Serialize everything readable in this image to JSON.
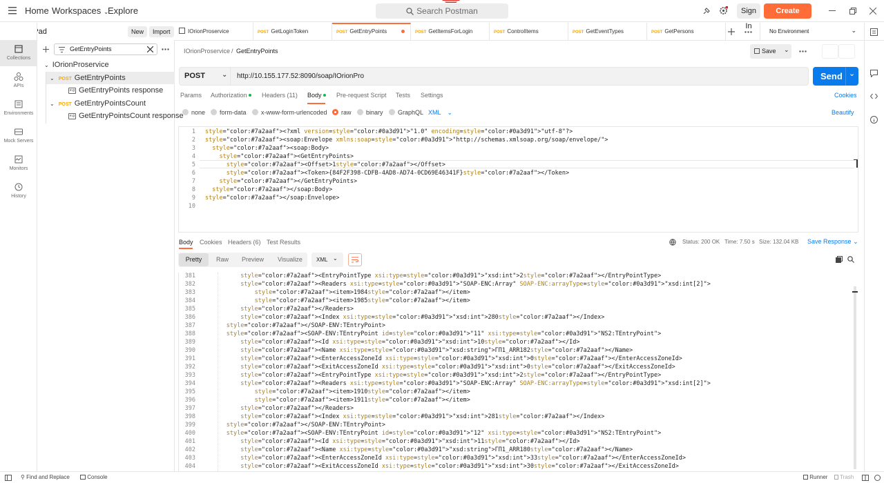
{
  "topbar": {
    "home": "Home",
    "workspaces": "Workspaces",
    "explore": "Explore",
    "search_placeholder": "Search Postman",
    "sign_in": "Sign In",
    "create_account": "Create Account"
  },
  "colors": {
    "accent": "#ff6c37",
    "send": "#097bed",
    "post": "#f6a80a"
  },
  "rail": [
    {
      "label": "Collections",
      "icon": "collections-icon"
    },
    {
      "label": "APIs",
      "icon": "apis-icon"
    },
    {
      "label": "Environments",
      "icon": "environments-icon"
    },
    {
      "label": "Mock Servers",
      "icon": "mock-servers-icon"
    },
    {
      "label": "Monitors",
      "icon": "monitors-icon"
    },
    {
      "label": "History",
      "icon": "history-icon"
    }
  ],
  "sidebar": {
    "title": "Scratch Pad",
    "new": "New",
    "import": "Import",
    "filter_value": "GetEntryPoints",
    "tree": [
      {
        "label": "IOrionProservice"
      },
      {
        "method": "POST",
        "label": "GetEntryPoints"
      },
      {
        "label": "GetEntryPoints response"
      },
      {
        "method": "POST",
        "label": "GetEntryPointsCount"
      },
      {
        "label": "GetEntryPointsCount response"
      }
    ]
  },
  "tabs": [
    {
      "method": "",
      "label": "IOrionProservice"
    },
    {
      "method": "POST",
      "label": "GetLoginToken"
    },
    {
      "method": "POST",
      "label": "GetEntryPoints"
    },
    {
      "method": "POST",
      "label": "GetItemsForLogin"
    },
    {
      "method": "POST",
      "label": "ControlItems"
    },
    {
      "method": "POST",
      "label": "GetEventTypes"
    },
    {
      "method": "POST",
      "label": "GetPersons"
    }
  ],
  "environment": "No Environment",
  "breadcrumb": {
    "parent": "IOrionProservice",
    "sep": "/",
    "current": "GetEntryPoints"
  },
  "save": "Save",
  "request": {
    "method": "POST",
    "url": "http://10.155.177.52:8090/soap/IOrionPro",
    "send": "Send"
  },
  "req_tabs": [
    "Params",
    "Authorization",
    "Headers (11)",
    "Body",
    "Pre-request Script",
    "Tests",
    "Settings"
  ],
  "cookies": "Cookies",
  "body_types": [
    "none",
    "form-data",
    "x-www-form-urlencoded",
    "raw",
    "binary",
    "GraphQL"
  ],
  "body_format": "XML",
  "beautify": "Beautify",
  "request_body": [
    {
      "n": "1",
      "t": "<?xml version=\"1.0\" encoding=\"utf-8\"?>"
    },
    {
      "n": "2",
      "t": "<soap:Envelope xmlns:soap=\"http://schemas.xmlsoap.org/soap/envelope/\">"
    },
    {
      "n": "3",
      "t": "  <soap:Body>"
    },
    {
      "n": "4",
      "t": "    <GetEntryPoints>"
    },
    {
      "n": "5",
      "t": "      <Offset>1</Offset>"
    },
    {
      "n": "6",
      "t": "      <Token>{84F2F398-CDFB-4AD8-AD74-0CD69E46341F}</Token>"
    },
    {
      "n": "7",
      "t": "    </GetEntryPoints>"
    },
    {
      "n": "8",
      "t": "  </soap:Body>"
    },
    {
      "n": "9",
      "t": "</soap:Envelope>"
    },
    {
      "n": "10",
      "t": ""
    }
  ],
  "resp_tabs": [
    "Body",
    "Cookies",
    "Headers (6)",
    "Test Results"
  ],
  "status": {
    "status": "Status: 200 OK",
    "time": "Time: 7.50 s",
    "size": "Size: 132.04 KB"
  },
  "save_response": "Save Response",
  "view_modes": [
    "Pretty",
    "Raw",
    "Preview",
    "Visualize"
  ],
  "resp_format": "XML",
  "response_body": [
    {
      "n": "381",
      "t": "          <EntryPointType xsi:type=\"xsd:int\">2</EntryPointType>"
    },
    {
      "n": "382",
      "t": "          <Readers xsi:type=\"SOAP-ENC:Array\" SOAP-ENC:arrayType=\"xsd:int[2]\">"
    },
    {
      "n": "383",
      "t": "              <item>1984</item>"
    },
    {
      "n": "384",
      "t": "              <item>1985</item>"
    },
    {
      "n": "385",
      "t": "          </Readers>"
    },
    {
      "n": "386",
      "t": "          <Index xsi:type=\"xsd:int\">280</Index>"
    },
    {
      "n": "387",
      "t": "      </SOAP-ENV:TEntryPoint>"
    },
    {
      "n": "388",
      "t": "      <SOAP-ENV:TEntryPoint id=\"11\" xsi:type=\"NS2:TEntryPoint\">"
    },
    {
      "n": "389",
      "t": "          <Id xsi:type=\"xsd:int\">10</Id>"
    },
    {
      "n": "390",
      "t": "          <Name xsi:type=\"xsd:string\">ГП1_ARR182</Name>"
    },
    {
      "n": "391",
      "t": "          <EnterAccessZoneId xsi:type=\"xsd:int\">0</EnterAccessZoneId>"
    },
    {
      "n": "392",
      "t": "          <ExitAccessZoneId xsi:type=\"xsd:int\">0</ExitAccessZoneId>"
    },
    {
      "n": "393",
      "t": "          <EntryPointType xsi:type=\"xsd:int\">2</EntryPointType>"
    },
    {
      "n": "394",
      "t": "          <Readers xsi:type=\"SOAP-ENC:Array\" SOAP-ENC:arrayType=\"xsd:int[2]\">"
    },
    {
      "n": "395",
      "t": "              <item>1910</item>"
    },
    {
      "n": "396",
      "t": "              <item>1911</item>"
    },
    {
      "n": "397",
      "t": "          </Readers>"
    },
    {
      "n": "398",
      "t": "          <Index xsi:type=\"xsd:int\">281</Index>"
    },
    {
      "n": "399",
      "t": "      </SOAP-ENV:TEntryPoint>"
    },
    {
      "n": "400",
      "t": "      <SOAP-ENV:TEntryPoint id=\"12\" xsi:type=\"NS2:TEntryPoint\">"
    },
    {
      "n": "401",
      "t": "          <Id xsi:type=\"xsd:int\">11</Id>"
    },
    {
      "n": "402",
      "t": "          <Name xsi:type=\"xsd:string\">ГП1_ARR180</Name>"
    },
    {
      "n": "403",
      "t": "          <EnterAccessZoneId xsi:type=\"xsd:int\">33</EnterAccessZoneId>"
    },
    {
      "n": "404",
      "t": "          <ExitAccessZoneId xsi:type=\"xsd:int\">30</ExitAccessZoneId>"
    }
  ],
  "footer": {
    "find_replace": "Find and Replace",
    "console": "Console",
    "runner": "Runner",
    "trash": "Trash"
  }
}
